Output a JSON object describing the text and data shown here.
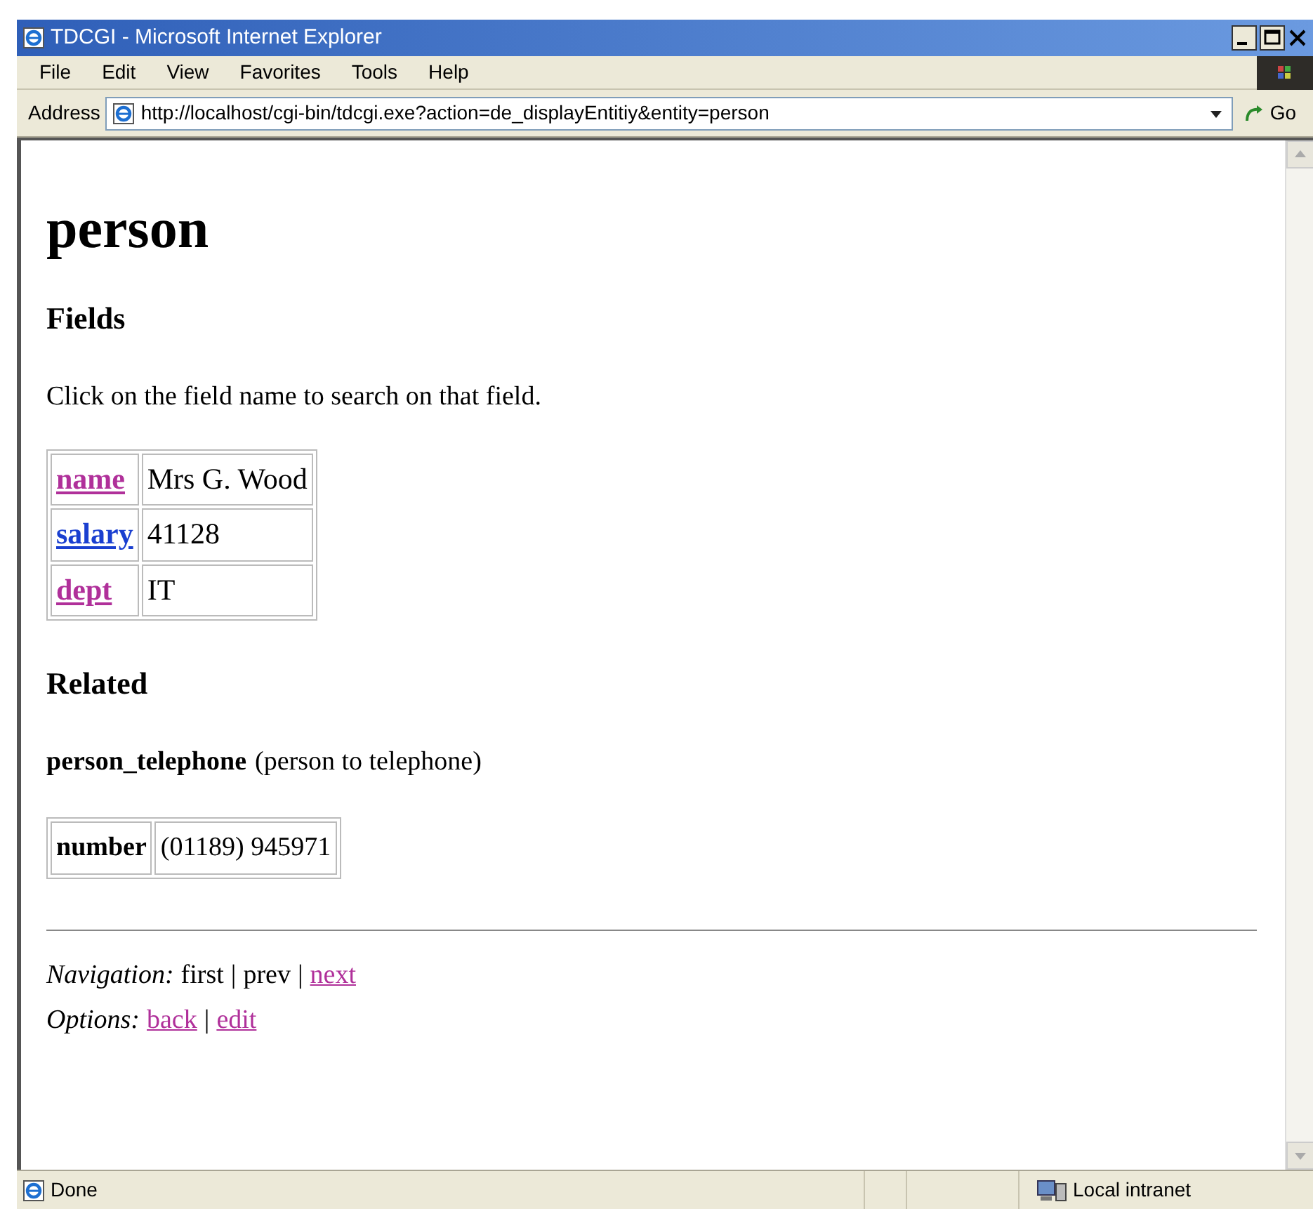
{
  "window": {
    "title": "TDCGI - Microsoft Internet Explorer"
  },
  "menu": [
    "File",
    "Edit",
    "View",
    "Favorites",
    "Tools",
    "Help"
  ],
  "address": {
    "label": "Address",
    "value": "http://localhost/cgi-bin/tdcgi.exe?action=de_displayEntitiy&entity=person",
    "go": "Go"
  },
  "page": {
    "heading": "person",
    "fields_heading": "Fields",
    "instruction": "Click on the field name to search on that field.",
    "fields": [
      {
        "name": "name",
        "visited": true,
        "value": "Mrs G. Wood"
      },
      {
        "name": "salary",
        "visited": false,
        "value": "41128"
      },
      {
        "name": "dept",
        "visited": true,
        "value": "IT"
      }
    ],
    "related_heading": "Related",
    "relation": {
      "name": "person_telephone",
      "description": "(person to telephone)"
    },
    "related_rows": [
      {
        "label": "number",
        "value": "(01189) 945971"
      }
    ],
    "footer": [
      {
        "label": "Navigation:",
        "items": [
          {
            "kind": "text",
            "text": "first"
          },
          {
            "kind": "separator",
            "text": "|"
          },
          {
            "kind": "text",
            "text": "prev"
          },
          {
            "kind": "separator",
            "text": "|"
          },
          {
            "kind": "link",
            "text": "next",
            "visited": true
          }
        ]
      },
      {
        "label": "Options:",
        "items": [
          {
            "kind": "link",
            "text": "back",
            "visited": true
          },
          {
            "kind": "separator",
            "text": "|"
          },
          {
            "kind": "link",
            "text": "edit",
            "visited": true
          }
        ]
      }
    ]
  },
  "status_bar": {
    "text": "Done",
    "zone": "Local intranet"
  }
}
